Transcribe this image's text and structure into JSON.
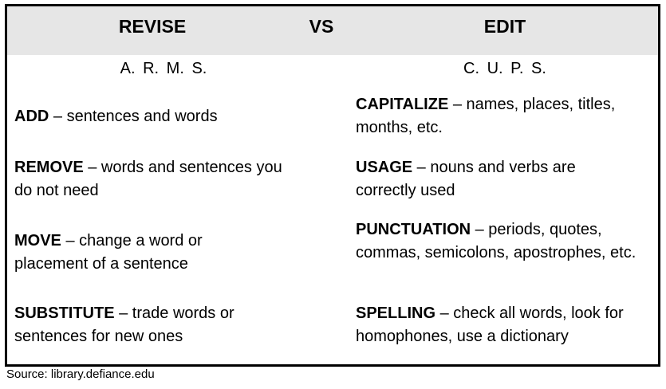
{
  "header": {
    "left": "REVISE",
    "middle": "VS",
    "right": "EDIT"
  },
  "revise": {
    "acronym": "A.  R.  M.  S.",
    "items": [
      {
        "term": "ADD",
        "desc": " – sentences and words"
      },
      {
        "term": "REMOVE",
        "desc": " – words and sentences you do not need"
      },
      {
        "term": "MOVE",
        "desc": " – change a word or placement of a sentence"
      },
      {
        "term": "SUBSTITUTE",
        "desc": " – trade words or sentences for new ones"
      }
    ]
  },
  "edit": {
    "acronym": "C.  U.  P.  S.",
    "items": [
      {
        "term": "CAPITALIZE",
        "desc": " – names, places, titles, months, etc."
      },
      {
        "term": "USAGE",
        "desc": " – nouns and verbs are correctly used"
      },
      {
        "term": "PUNCTUATION",
        "desc": " – periods, quotes, commas, semicolons, apostrophes, etc."
      },
      {
        "term": "SPELLING",
        "desc": " – check all words, look for homophones, use a dictionary"
      }
    ]
  },
  "source": "Source: library.defiance.edu"
}
